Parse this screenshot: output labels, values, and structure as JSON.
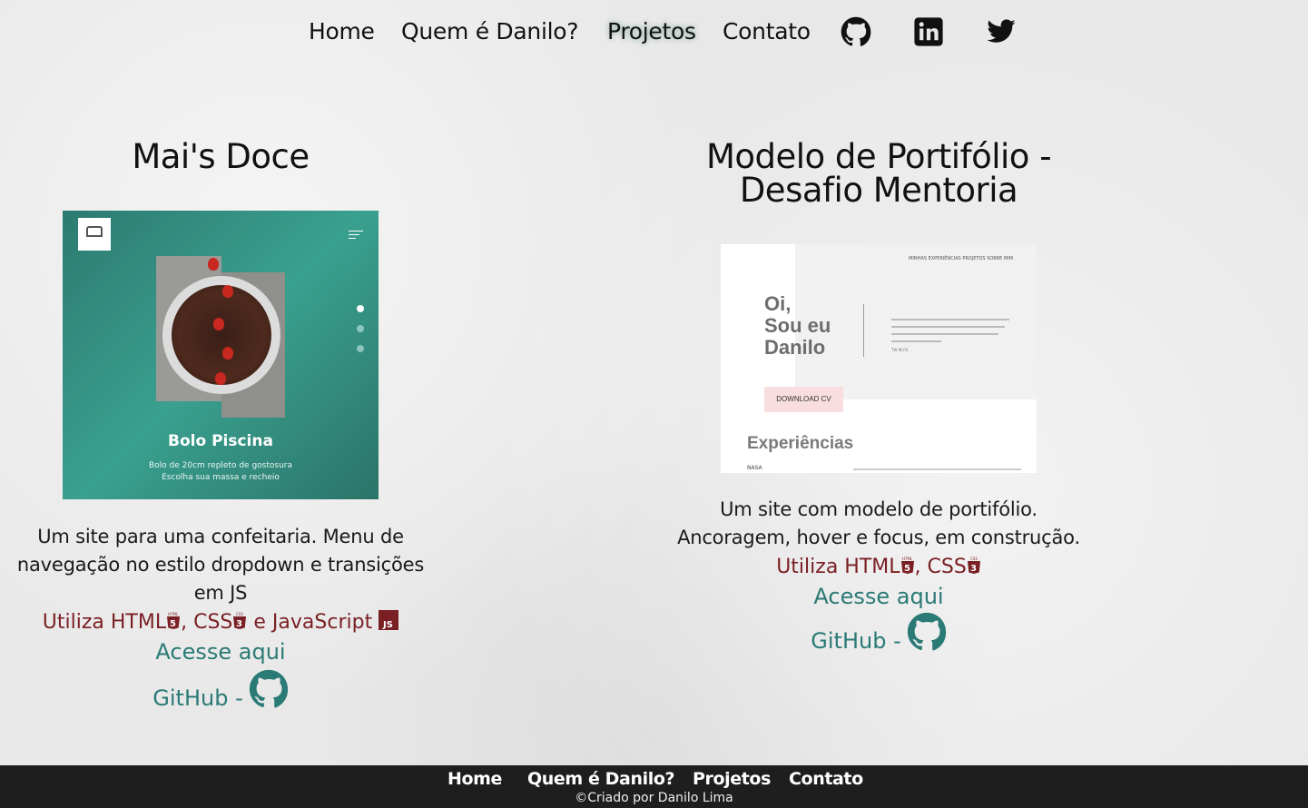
{
  "nav": {
    "items": [
      {
        "label": "Home"
      },
      {
        "label": "Quem é Danilo?"
      },
      {
        "label": "Projetos"
      },
      {
        "label": "Contato"
      }
    ],
    "active": "Projetos",
    "social": [
      "github-icon",
      "linkedin-icon",
      "twitter-icon"
    ]
  },
  "projects": [
    {
      "title": "Mai's Doce",
      "preview": {
        "heading": "Bolo Piscina",
        "line1": "Bolo de 20cm repleto de gostosura",
        "line2": "Escolha sua massa e recheio"
      },
      "description_lines": [
        "Um site para uma confeitaria. Menu de",
        "navegação no estilo dropdown e transições",
        "em JS"
      ],
      "tech_prefix": "Utiliza HTML",
      "tech_css": ", CSS",
      "tech_js": " e JavaScript",
      "access": "Acesse aqui",
      "github": "GitHub -"
    },
    {
      "title_line1": "Modelo de Portifólio -",
      "title_line2": "Desafio Mentoria",
      "preview": {
        "nav": "MINHAS EXPERIÊNCIAS    PROJETOS    SOBRE MIM",
        "hero_line1": "Oi,",
        "hero_line2": "Sou eu",
        "hero_line3": "Danilo",
        "social": "TW      IN      FB",
        "button": "DOWNLOAD CV",
        "section": "Experiências",
        "row": "NASA"
      },
      "description_lines": [
        "Um site com modelo de portifólio.",
        "Ancoragem, hover e focus, em construção."
      ],
      "tech_prefix": "Utiliza HTML",
      "tech_css": ", CSS",
      "access": "Acesse aqui",
      "github": "GitHub -"
    }
  ],
  "footer": {
    "items": [
      "Home",
      "Quem é Danilo?",
      "Projetos",
      "Contato"
    ],
    "copyright": "©Criado por Danilo Lima"
  },
  "colors": {
    "accent": "#2a7a76",
    "tech": "#7a1f24",
    "footer_bg": "#1e1e1e"
  }
}
